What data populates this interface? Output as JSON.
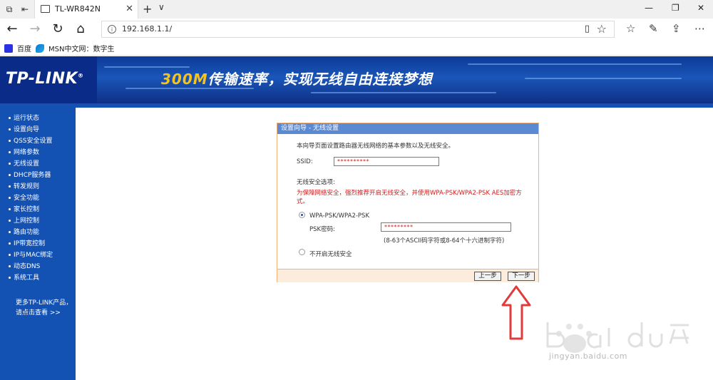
{
  "browser": {
    "tab_title": "TL-WR842N",
    "url": "192.168.1.1/",
    "favorites": [
      {
        "label": "百度",
        "icon": "baidu-icon"
      },
      {
        "label": "MSN中文网：数字生",
        "icon": "msn-icon"
      }
    ]
  },
  "banner": {
    "logo": "TP-LINK",
    "slogan_highlight": "300M",
    "slogan_rest": "传输速率，实现无线自由连接梦想"
  },
  "sidebar": {
    "items": [
      "运行状态",
      "设置向导",
      "QSS安全设置",
      "网络参数",
      "无线设置",
      "DHCP服务器",
      "转发规则",
      "安全功能",
      "家长控制",
      "上网控制",
      "路由功能",
      "IP带宽控制",
      "IP与MAC绑定",
      "动态DNS",
      "系统工具"
    ],
    "more_line1": "更多TP-LINK产品，",
    "more_line2": "请点击查看 >>"
  },
  "wizard": {
    "title": "设置向导 - 无线设置",
    "intro": "本向导页面设置路由器无线网络的基本参数以及无线安全。",
    "ssid_label": "SSID:",
    "ssid_value": "**********",
    "security_label": "无线安全选项:",
    "warning": "为保障网络安全，强烈推荐开启无线安全，并使用WPA-PSK/WPA2-PSK AES加密方式。",
    "option_wpa": "WPA-PSK/WPA2-PSK",
    "psk_label": "PSK密码:",
    "psk_value": "*********",
    "psk_hint": "(8-63个ASCII码字符或8-64个十六进制字符)",
    "option_none": "不开启无线安全",
    "prev_button": "上一步",
    "next_button": "下一步"
  },
  "watermark": {
    "url_text": "jingyan.baidu.com"
  },
  "colors": {
    "banner": "#0d2f8a",
    "sidebar": "#1351b3",
    "panel_title": "#5c8ad2",
    "panel_border": "#f1b37a",
    "warning": "#d21b1b",
    "arrow": "#e23b3b"
  }
}
